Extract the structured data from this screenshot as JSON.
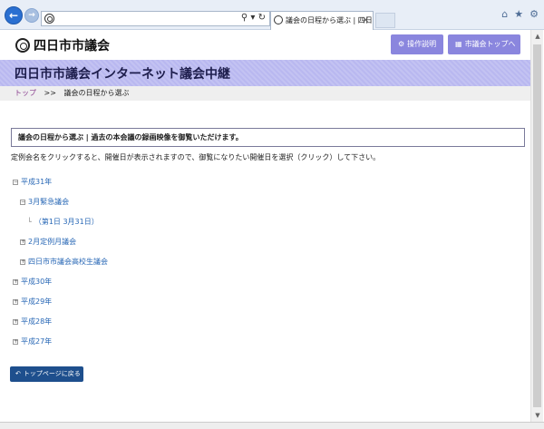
{
  "browser": {
    "tab_title": "議会の日程から選ぶ | 四日..."
  },
  "header": {
    "logo_text": "四日市市議会",
    "guide_button": "操作説明",
    "top_button": "市議会トップへ"
  },
  "banner": {
    "title": "四日市市議会インターネット議会中継"
  },
  "breadcrumb": {
    "home": "トップ",
    "separator": ">>",
    "current": "議会の日程から選ぶ"
  },
  "notice": "議会の日程から選ぶ | 過去の本会議の録画映像を御覧いただけます。",
  "instruction": "定例会名をクリックすると、開催日が表示されますので、御覧になりたい開催日を選択（クリック）して下さい。",
  "tree": [
    {
      "label": "平成31年",
      "level": 0,
      "expanded": true
    },
    {
      "label": "3月緊急議会",
      "level": 1,
      "expanded": true
    },
    {
      "label": "（第1日 3月31日）",
      "level": 2,
      "leaf": true
    },
    {
      "label": "2月定例月議会",
      "level": 1,
      "expanded": false
    },
    {
      "label": "四日市市議会高校生議会",
      "level": 1,
      "expanded": false
    },
    {
      "label": "平成30年",
      "level": 0,
      "expanded": false
    },
    {
      "label": "平成29年",
      "level": 0,
      "expanded": false
    },
    {
      "label": "平成28年",
      "level": 0,
      "expanded": false
    },
    {
      "label": "平成27年",
      "level": 0,
      "expanded": false
    }
  ],
  "return_button": "トップページに戻る",
  "colors": {
    "accent": "#8a86de",
    "banner": "#b9b8f0",
    "link": "#2968b6",
    "return_button": "#1e4f8d"
  }
}
